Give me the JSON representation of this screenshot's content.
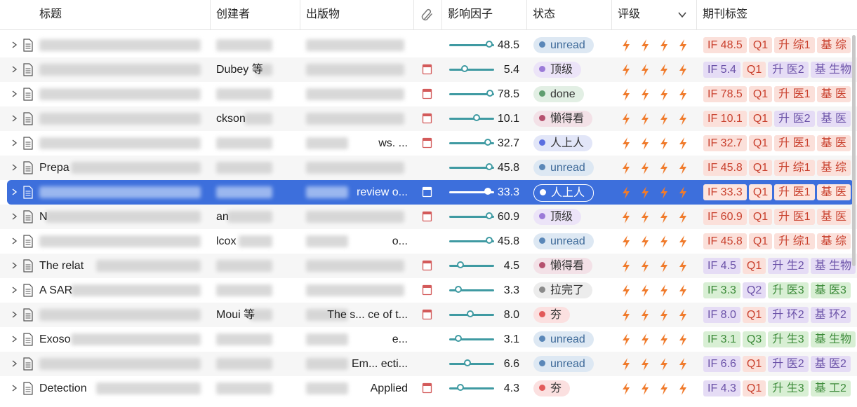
{
  "header": {
    "title": "标题",
    "creator": "创建者",
    "publication": "出版物",
    "impact_factor": "影响因子",
    "status": "状态",
    "rating": "评级",
    "journal_tags": "期刊标签"
  },
  "colors": {
    "accent": "#3f9aa2",
    "selected_row": "#3d6fdc",
    "bolt": "#f07b2c"
  },
  "rows": [
    {
      "title": "",
      "creator": "",
      "publication": "",
      "if": "48.5",
      "if_fraction": 0.92,
      "status": "unread",
      "status_color": "#5a87b8",
      "status_bg": "#dde8f3",
      "tags": [
        [
          "IF 48.5",
          "red"
        ],
        [
          "Q1",
          "red"
        ],
        [
          "升 综1",
          "red"
        ],
        [
          "基 综",
          "red"
        ]
      ],
      "pdf": false
    },
    {
      "title": "",
      "creator": "Dubey 等",
      "publication": "",
      "if": "5.4",
      "if_fraction": 0.3,
      "status": "顶级",
      "status_color": "#9b7ad8",
      "status_bg": "#ece4f8",
      "tags": [
        [
          "IF 5.4",
          "pur"
        ],
        [
          "Q1",
          "red"
        ],
        [
          "升 医2",
          "pur"
        ],
        [
          "基 生物",
          "pur"
        ]
      ],
      "pdf": true
    },
    {
      "title": "",
      "creator": "",
      "publication": "",
      "if": "78.5",
      "if_fraction": 0.95,
      "status": "done",
      "status_color": "#5f9e6f",
      "status_bg": "#e2efe4",
      "tags": [
        [
          "IF 78.5",
          "red"
        ],
        [
          "Q1",
          "red"
        ],
        [
          "升 医1",
          "red"
        ],
        [
          "基 医",
          "red"
        ]
      ],
      "pdf": true
    },
    {
      "title": "",
      "creator": "ckson",
      "publication": "",
      "if": "10.1",
      "if_fraction": 0.6,
      "status": "懒得看",
      "status_color": "#b5506e",
      "status_bg": "#f3e1e7",
      "tags": [
        [
          "IF 10.1",
          "red"
        ],
        [
          "Q1",
          "red"
        ],
        [
          "升 医2",
          "pur"
        ],
        [
          "基 医",
          "pur"
        ]
      ],
      "pdf": true
    },
    {
      "title": "",
      "creator": "",
      "publication": "ws. ...",
      "if": "32.7",
      "if_fraction": 0.9,
      "status": "人上人",
      "status_color": "#5a6ee0",
      "status_bg": "#e2e6f8",
      "tags": [
        [
          "IF 32.7",
          "red"
        ],
        [
          "Q1",
          "red"
        ],
        [
          "升 医1",
          "red"
        ],
        [
          "基 医",
          "red"
        ]
      ],
      "pdf": true
    },
    {
      "title": "Prepa",
      "creator": "",
      "publication": "",
      "if": "45.8",
      "if_fraction": 0.92,
      "status": "unread",
      "status_color": "#5a87b8",
      "status_bg": "#dde8f3",
      "tags": [
        [
          "IF 45.8",
          "red"
        ],
        [
          "Q1",
          "red"
        ],
        [
          "升 综1",
          "red"
        ],
        [
          "基 综",
          "red"
        ]
      ],
      "pdf": false
    },
    {
      "title": "",
      "creator": "",
      "publication": "review o...",
      "if": "33.3",
      "if_fraction": 0.9,
      "status": "人上人",
      "status_color": "#ffffff",
      "status_bg": "#3d6fdc",
      "tags": [
        [
          "IF 33.3",
          "red"
        ],
        [
          "Q1",
          "red"
        ],
        [
          "升 医1",
          "red"
        ],
        [
          "基 医",
          "red"
        ]
      ],
      "pdf": true,
      "selected": true
    },
    {
      "title": "N",
      "creator": "an",
      "publication": "",
      "if": "60.9",
      "if_fraction": 0.93,
      "status": "顶级",
      "status_color": "#9b7ad8",
      "status_bg": "#ece4f8",
      "tags": [
        [
          "IF 60.9",
          "red"
        ],
        [
          "Q1",
          "red"
        ],
        [
          "升 医1",
          "red"
        ],
        [
          "基 医",
          "red"
        ]
      ],
      "pdf": true
    },
    {
      "title": "",
      "creator": "lcox",
      "publication": "o...",
      "if": "45.8",
      "if_fraction": 0.92,
      "status": "unread",
      "status_color": "#5a87b8",
      "status_bg": "#dde8f3",
      "tags": [
        [
          "IF 45.8",
          "red"
        ],
        [
          "Q1",
          "red"
        ],
        [
          "升 综1",
          "red"
        ],
        [
          "基 综",
          "red"
        ]
      ],
      "pdf": false
    },
    {
      "title": "The relat",
      "creator": "",
      "publication": "",
      "if": "4.5",
      "if_fraction": 0.2,
      "status": "懒得看",
      "status_color": "#b5506e",
      "status_bg": "#f3e1e7",
      "tags": [
        [
          "IF 4.5",
          "pur"
        ],
        [
          "Q1",
          "red"
        ],
        [
          "升 生2",
          "pur"
        ],
        [
          "基 生物",
          "pur"
        ]
      ],
      "pdf": true
    },
    {
      "title": "A SAR",
      "creator": "",
      "publication": "",
      "if": "3.3",
      "if_fraction": 0.15,
      "status": "拉完了",
      "status_color": "#8a8a8a",
      "status_bg": "#ececec",
      "tags": [
        [
          "IF 3.3",
          "grn"
        ],
        [
          "Q2",
          "pur"
        ],
        [
          "升 医3",
          "grn"
        ],
        [
          "基 医3",
          "grn"
        ]
      ],
      "pdf": true
    },
    {
      "title": "",
      "creator": "Moui 等",
      "publication": "The s... ce of t...",
      "if": "8.0",
      "if_fraction": 0.45,
      "status": "夯",
      "status_color": "#e25a5a",
      "status_bg": "#fbe0e0",
      "tags": [
        [
          "IF 8.0",
          "pur"
        ],
        [
          "Q1",
          "red"
        ],
        [
          "升 环2",
          "pur"
        ],
        [
          "基 环2",
          "pur"
        ]
      ],
      "pdf": true
    },
    {
      "title": "Exoso",
      "creator": "",
      "publication": "e...",
      "if": "3.1",
      "if_fraction": 0.15,
      "status": "unread",
      "status_color": "#5a87b8",
      "status_bg": "#dde8f3",
      "tags": [
        [
          "IF 3.1",
          "grn"
        ],
        [
          "Q3",
          "grn"
        ],
        [
          "升 生3",
          "grn"
        ],
        [
          "基 生物",
          "grn"
        ]
      ],
      "pdf": false
    },
    {
      "title": "",
      "creator": "",
      "publication": "Em... ecti...",
      "if": "6.6",
      "if_fraction": 0.38,
      "status": "unread",
      "status_color": "#5a87b8",
      "status_bg": "#dde8f3",
      "tags": [
        [
          "IF 6.6",
          "pur"
        ],
        [
          "Q1",
          "red"
        ],
        [
          "升 医2",
          "pur"
        ],
        [
          "基 医2",
          "pur"
        ]
      ],
      "pdf": false
    },
    {
      "title": "Detection",
      "creator": "",
      "publication": "Applied",
      "if": "4.3",
      "if_fraction": 0.2,
      "status": "夯",
      "status_color": "#e25a5a",
      "status_bg": "#fbe0e0",
      "tags": [
        [
          "IF 4.3",
          "pur"
        ],
        [
          "Q1",
          "red"
        ],
        [
          "升 生3",
          "grn"
        ],
        [
          "基 工2",
          "grn"
        ]
      ],
      "pdf": true
    }
  ]
}
